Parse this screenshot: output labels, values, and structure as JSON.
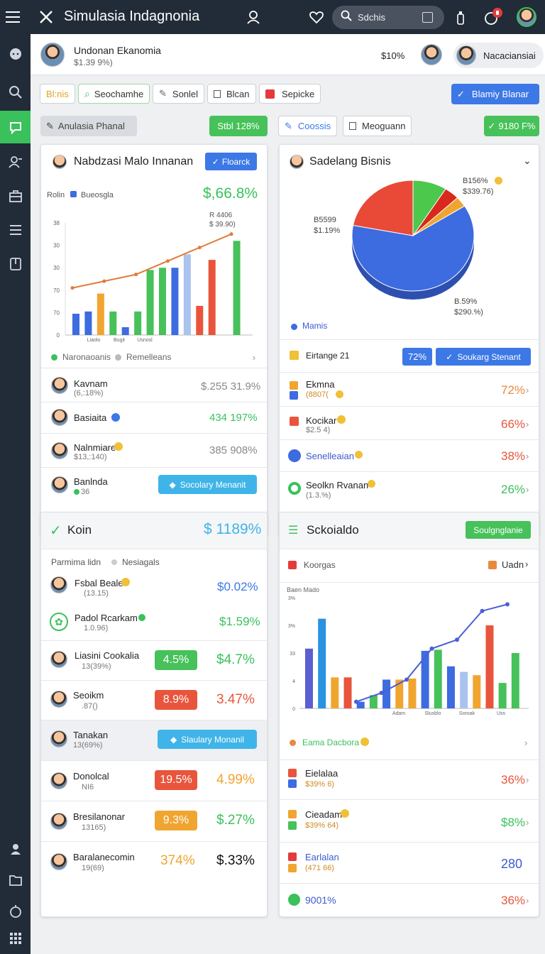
{
  "app": {
    "title": "Simulasia Indagnonia",
    "search_label": "Sdchis"
  },
  "header": {
    "name": "Undonan Ekanomia",
    "sub": "$1.39 9%)",
    "value": "$10%",
    "user_label": "Nacaciansiai"
  },
  "toolbar": {
    "b1": "Bl:nis",
    "b2": "Seochamhe",
    "b3": "Sonlel",
    "b4": "Blcan",
    "b5": "Sepicke",
    "primary": "Blamiy Blanar"
  },
  "toolbar2": {
    "b1": "Anulasia Phanal",
    "badge1": "Stbl 128%",
    "b2": "Coossis",
    "b3": "Meoguann",
    "badge2": "9180 F%"
  },
  "card1": {
    "title": "Nabdzasi Malo Innanan",
    "action": "Floarck",
    "legend_a": "Rolin",
    "legend_b": "Bueosgla",
    "big": "$,66.8%",
    "annot1": "R 4406",
    "annot2": "$ 39.90)",
    "footer_a": "Naronaoanis",
    "footer_b": "Remelleans",
    "rows": [
      {
        "name": "Kavnam",
        "sub": "(6,:18%)",
        "value": "$.255 31.9%"
      },
      {
        "name": "Basiaita",
        "sub": "",
        "value": "434 197%"
      },
      {
        "name": "Nalnmiare",
        "sub": "$13,:140)",
        "value": "385 908%"
      },
      {
        "name": "Banlnda",
        "sub": "36",
        "button": "Socolary Menanit"
      }
    ]
  },
  "card2": {
    "title": "Sadelang Bisnis",
    "label1": "B156%",
    "label1b": "$339.76)",
    "label2": "B5599",
    "label2b": "$1.19%",
    "label3": "B.59%",
    "label3b": "$290.%)",
    "legend": "Mamis",
    "filter": "Eirtange 21",
    "badge": "72%",
    "button": "Soukarg Stenant",
    "rows": [
      {
        "name": "Ekmna",
        "sub": "(8807(",
        "value": "72%"
      },
      {
        "name": "Kocikar",
        "sub": "$2.5 4)",
        "value": "66%"
      },
      {
        "name": "Senelleaian",
        "sub": "",
        "value": "38%"
      },
      {
        "name": "Seolkn Rvanan",
        "sub": "(1.3.%)",
        "value": "26%"
      }
    ]
  },
  "card3": {
    "title": "Koin",
    "big": "$ 1189%",
    "filter_a": "Parmima lidn",
    "filter_b": "Nesiagals",
    "rows": [
      {
        "name": "Fsbal Beale",
        "sub": "(13.15)",
        "value": "$0.02%"
      },
      {
        "name": "Padol Rcarkam",
        "sub": "1.0.96)",
        "value": "$1.59%"
      },
      {
        "name": "Liasini Cookalia",
        "sub": "13(39%)",
        "tag": "4.5%",
        "value": "$4.7%"
      },
      {
        "name": "Seoikm",
        "sub": ".87()",
        "tag": "8.9%",
        "value": "3.47%"
      },
      {
        "name": "Tanakan",
        "sub": "13(69%)",
        "button": "Slaulary Monanil"
      },
      {
        "name": "Donolcal",
        "sub": "NI6",
        "tag": "19.5%",
        "value": "4.99%"
      },
      {
        "name": "Bresilanonar",
        "sub": "13165)",
        "tag": "9.3%",
        "value": "$.27%"
      },
      {
        "name": "Baralanecomin",
        "sub": "19(69)",
        "tag": "374%",
        "value": "$.33%"
      }
    ]
  },
  "card4": {
    "title": "Sckoialdo",
    "action": "Soulgnglanie",
    "legend_a": "Koorgas",
    "legend_b": "Uadn",
    "chart_label": "Baen Mado",
    "footer": "Eama Dacbora",
    "rows": [
      {
        "name": "Eielalaa",
        "sub": "$39% 6)",
        "value": "36%"
      },
      {
        "name": "Cieadam",
        "sub": "$39% 64)",
        "value": "$8%"
      },
      {
        "name": "Earlalan",
        "sub": "(471 66)",
        "value": "280"
      },
      {
        "name": "9001%",
        "sub": "",
        "value": "36%"
      }
    ]
  },
  "chart_data": [
    {
      "type": "bar",
      "title": "Nabdzasi Malo Innanan",
      "ylabel": "",
      "xlabel": "",
      "y_ticks": [
        "0",
        "70",
        "70",
        "30",
        "30",
        "38"
      ],
      "x_ticks": [
        "Liaolo",
        "Bugit",
        "Usnosl"
      ],
      "series": [
        {
          "name": "Rolin",
          "values": [
            19,
            21,
            37,
            21,
            7,
            21,
            58,
            60,
            60,
            72,
            26,
            67,
            0,
            84
          ]
        },
        {
          "name": "Bueosgla",
          "values": [
            42,
            48,
            54,
            66,
            78,
            90
          ]
        }
      ]
    },
    {
      "type": "pie",
      "title": "Sadelang Bisnis",
      "slices": [
        {
          "label": "B156%",
          "value": 62,
          "color": "#3d6be0"
        },
        {
          "label": "B5599",
          "value": 22,
          "color": "#e84a37"
        },
        {
          "label": "B.59%",
          "value": 9,
          "color": "#4cc84d"
        },
        {
          "label": "",
          "value": 4,
          "color": "#d9291d"
        },
        {
          "label": "",
          "value": 3,
          "color": "#f0a531"
        }
      ]
    },
    {
      "type": "bar",
      "title": "Sckoialdo",
      "y_ticks": [
        "0",
        "4",
        "33",
        "3%",
        "3%"
      ],
      "x_ticks": [
        "Adam",
        "Slusblo",
        "Soroak",
        "Uss"
      ],
      "series": [
        {
          "name": "Koorgas",
          "values": [
            54,
            81,
            28,
            28,
            6,
            12,
            26,
            26,
            27,
            52,
            53,
            38,
            33,
            30,
            75,
            23,
            50
          ]
        },
        {
          "name": "Uadn",
          "values": [
            6,
            14,
            26,
            54,
            62,
            88,
            94
          ]
        }
      ]
    }
  ],
  "colors": {
    "sidebar": "#222b38",
    "green": "#47c15a",
    "blue": "#3c78e6",
    "red": "#e8553c",
    "orange": "#f0a531",
    "teal": "#3fb4e9"
  }
}
